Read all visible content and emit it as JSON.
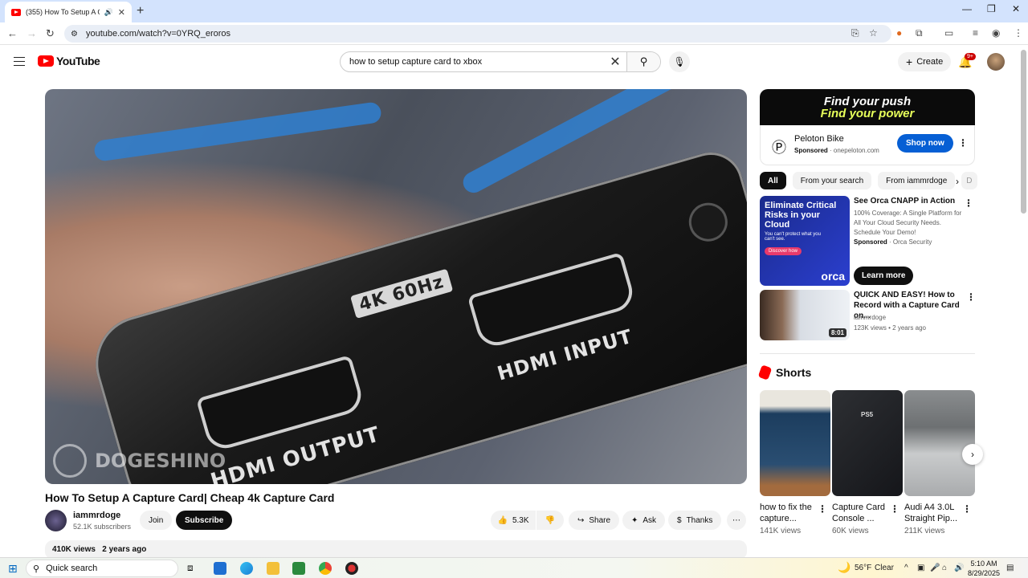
{
  "browser": {
    "tab_title": "(355) How To Setup A Capt",
    "url": "youtube.com/watch?v=0YRQ_eroros"
  },
  "header": {
    "logo_text": "YouTube",
    "search_value": "how to setup capture card to xbox",
    "create_label": "Create",
    "notif_badge": "9+"
  },
  "player": {
    "label_4k": "4K 60Hz",
    "label_out": "HDMI OUTPUT",
    "label_in": "HDMI INPUT",
    "watermark": "DOGESHINO"
  },
  "video": {
    "title": "How To Setup A Capture Card| Cheap 4k Capture Card",
    "channel": "iammrdoge",
    "subscribers": "52.1K subscribers",
    "join": "Join",
    "subscribe": "Subscribe",
    "likes": "5.3K",
    "share": "Share",
    "ask": "Ask",
    "thanks": "Thanks",
    "views": "410K views",
    "age": "2 years ago"
  },
  "ad": {
    "banner_1": "Find your push",
    "banner_2": "Find your power",
    "name": "Peloton Bike",
    "sponsored": "Sponsored",
    "domain": "onepeloton.com",
    "cta": "Shop now"
  },
  "chips": [
    "All",
    "From your search",
    "From iammrdoge",
    "D"
  ],
  "recs": [
    {
      "title": "See Orca CNAPP in Action",
      "desc": "100% Coverage: A Single Platform for All Your Cloud Security Needs. Schedule Your Demo!",
      "sponsored": "Sponsored",
      "advertiser": "Orca Security",
      "cta": "Learn more",
      "thumb_h1": "Eliminate Critical Risks in your Cloud",
      "thumb_h2": "You can't protect what you can't see.",
      "thumb_btn": "Discover how",
      "thumb_brand": "orca"
    },
    {
      "title": "QUICK AND EASY! How to Record with a Capture Card on...",
      "channel": "iammrdoge",
      "meta": "123K views • 2 years ago",
      "duration": "8:01"
    }
  ],
  "shorts": {
    "heading": "Shorts",
    "items": [
      {
        "title": "how to fix the capture...",
        "views": "141K views"
      },
      {
        "title": "Capture Card Console ...",
        "views": "60K views",
        "thumb_text": "PS5"
      },
      {
        "title": "Audi A4 3.0L Straight Pip...",
        "views": "211K views"
      }
    ]
  },
  "taskbar": {
    "search": "Quick search",
    "weather_temp": "56°F",
    "weather_cond": "Clear",
    "time": "5:10 AM",
    "date": "8/29/2025"
  },
  "colors": {
    "accent": "#065fd4",
    "yt_red": "#ff0000",
    "tab_strip": "#d3e3fd"
  }
}
